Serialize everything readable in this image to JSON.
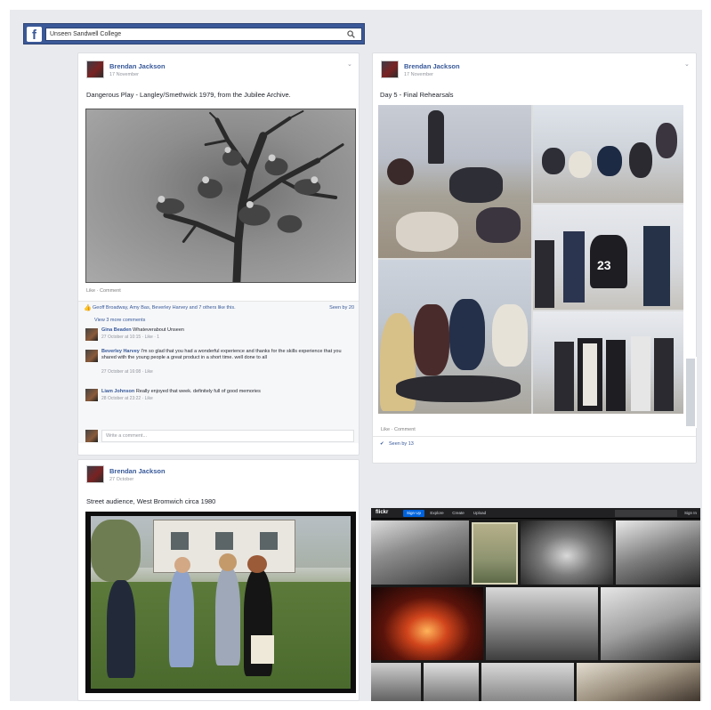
{
  "topbar": {
    "logo": "f",
    "search_value": "Unseen Sandwell College"
  },
  "post1": {
    "author": "Brendan Jackson",
    "date": "17 November",
    "text": "Dangerous Play - Langley/Smethwick 1979, from the Jubilee Archive.",
    "actions": "Like · Comment",
    "likes_text": "Geoff Broadway, Amy Bas, Beverley Harvey and 7 others like this.",
    "seen_by": "Seen by 20",
    "view_more": "View 3 more comments",
    "comments": [
      {
        "name": "Gina Beaden",
        "text": "Whateverabout Unseen",
        "meta": "27 October at 10:15 · Like · 1"
      },
      {
        "name": "Beverley Harvey",
        "text": "I'm so glad that you had a wonderful experience and thanks for the skills experience that you shared with the young people a great product in a short time. well done to all",
        "meta": "27 October at 16:08 · Like"
      },
      {
        "name": "Liam Johnson",
        "text": "Really enjoyed that week. definitely full of good memories",
        "meta": "28 October at 23:22 · Like"
      }
    ],
    "write_placeholder": "Write a comment..."
  },
  "post2": {
    "author": "Brendan Jackson",
    "date": "17 November",
    "text": "Day 5 - Final Rehearsals",
    "actions": "Like · Comment",
    "seen_by": "Seen by 13"
  },
  "post3": {
    "author": "Brendan Jackson",
    "date": "27 October",
    "text": "Street audience, West Bromwich circa 1980"
  },
  "flickr": {
    "logo": "flickr",
    "nav": [
      "Sign Up",
      "Explore",
      "Create",
      "Upload"
    ],
    "signin": "Sign In"
  },
  "colors": {
    "facebook_blue": "#3b5998",
    "link_blue": "#365899",
    "page_background": "#e9eaed",
    "flickr_dark": "#212124",
    "flickr_blue": "#0063dc"
  }
}
